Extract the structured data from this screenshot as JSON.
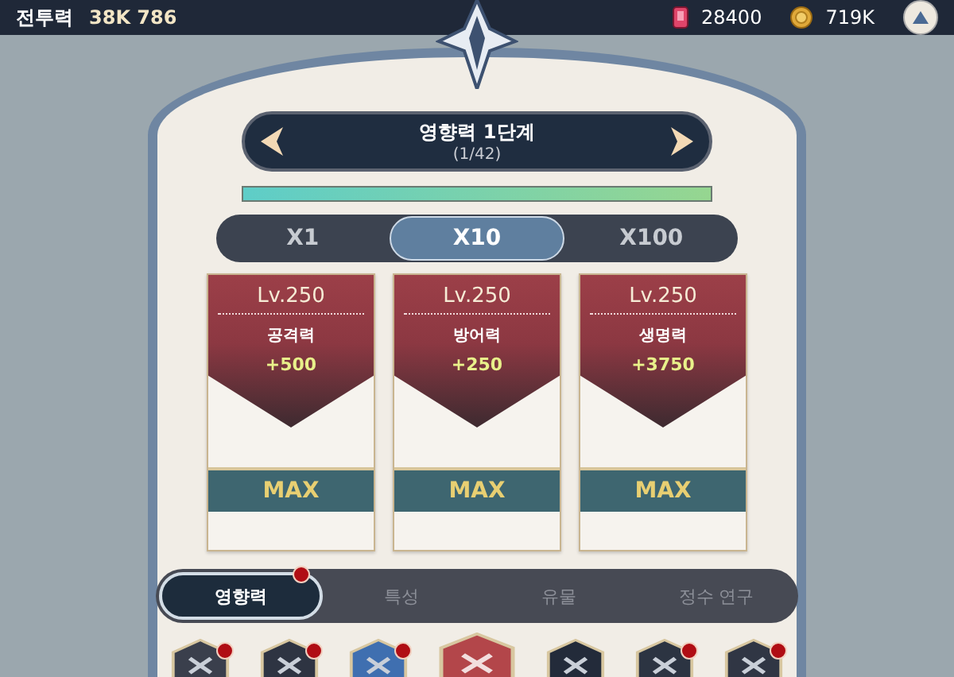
{
  "top_bar": {
    "power_label": "전투력",
    "power_value": "38K 786",
    "currencies": [
      {
        "kind": "gem",
        "amount": "28400"
      },
      {
        "kind": "coin",
        "amount": "719K"
      }
    ]
  },
  "stage": {
    "title": "영향력 1단계",
    "subtitle": "(1/42)",
    "level": 1
  },
  "multipliers": [
    {
      "label": "X1",
      "selected": false
    },
    {
      "label": "X10",
      "selected": true
    },
    {
      "label": "X100",
      "selected": false
    }
  ],
  "cards": [
    {
      "level": "Lv.250",
      "stat": "공격력",
      "bonus": "+500",
      "action": "MAX"
    },
    {
      "level": "Lv.250",
      "stat": "방어력",
      "bonus": "+250",
      "action": "MAX"
    },
    {
      "level": "Lv.250",
      "stat": "생명력",
      "bonus": "+3750",
      "action": "MAX"
    }
  ],
  "tabs": [
    {
      "label": "영향력",
      "selected": true,
      "notification": true
    },
    {
      "label": "특성",
      "selected": false,
      "notification": false
    },
    {
      "label": "유물",
      "selected": false,
      "notification": false
    },
    {
      "label": "정수 연구",
      "selected": false,
      "notification": false
    }
  ],
  "emblems": [
    {
      "selected": false,
      "notification": true
    },
    {
      "selected": false,
      "notification": true
    },
    {
      "selected": false,
      "notification": true
    },
    {
      "selected": true,
      "notification": false
    },
    {
      "selected": false,
      "notification": false
    },
    {
      "selected": false,
      "notification": true
    },
    {
      "selected": false,
      "notification": true
    }
  ]
}
